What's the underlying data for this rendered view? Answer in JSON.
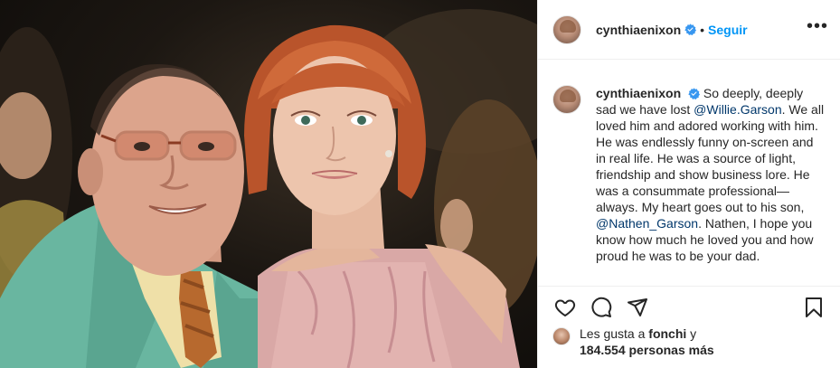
{
  "post": {
    "image_alt": ""
  },
  "header": {
    "username": "cynthiaenixon",
    "separator": "•",
    "follow_label": "Seguir",
    "more_label": "•••"
  },
  "caption": {
    "username": "cynthiaenixon",
    "text_1": "So deeply, deeply sad we have lost ",
    "mention_1": "@Willie.Garson",
    "text_2": ". We all loved him and adored working with him. He was endlessly funny on-screen and in real life. He was a source of light, friendship and show business lore. He was a consummate professional— always. My heart goes out to his son, ",
    "mention_2": "@Nathen_Garson",
    "text_3": ". Nathen, I hope you know how much he loved you and how proud he was to be your dad."
  },
  "actions": {
    "like": "heart-icon",
    "comment": "comment-icon",
    "share": "share-icon",
    "save": "bookmark-icon"
  },
  "likes": {
    "prefix": "Les gusta a ",
    "first_user": "fonchi",
    "middle": " y",
    "count": "184.554 personas más"
  },
  "colors": {
    "link": "#0095f6",
    "mention": "#00376b",
    "text": "#262626",
    "border": "#efefef"
  }
}
